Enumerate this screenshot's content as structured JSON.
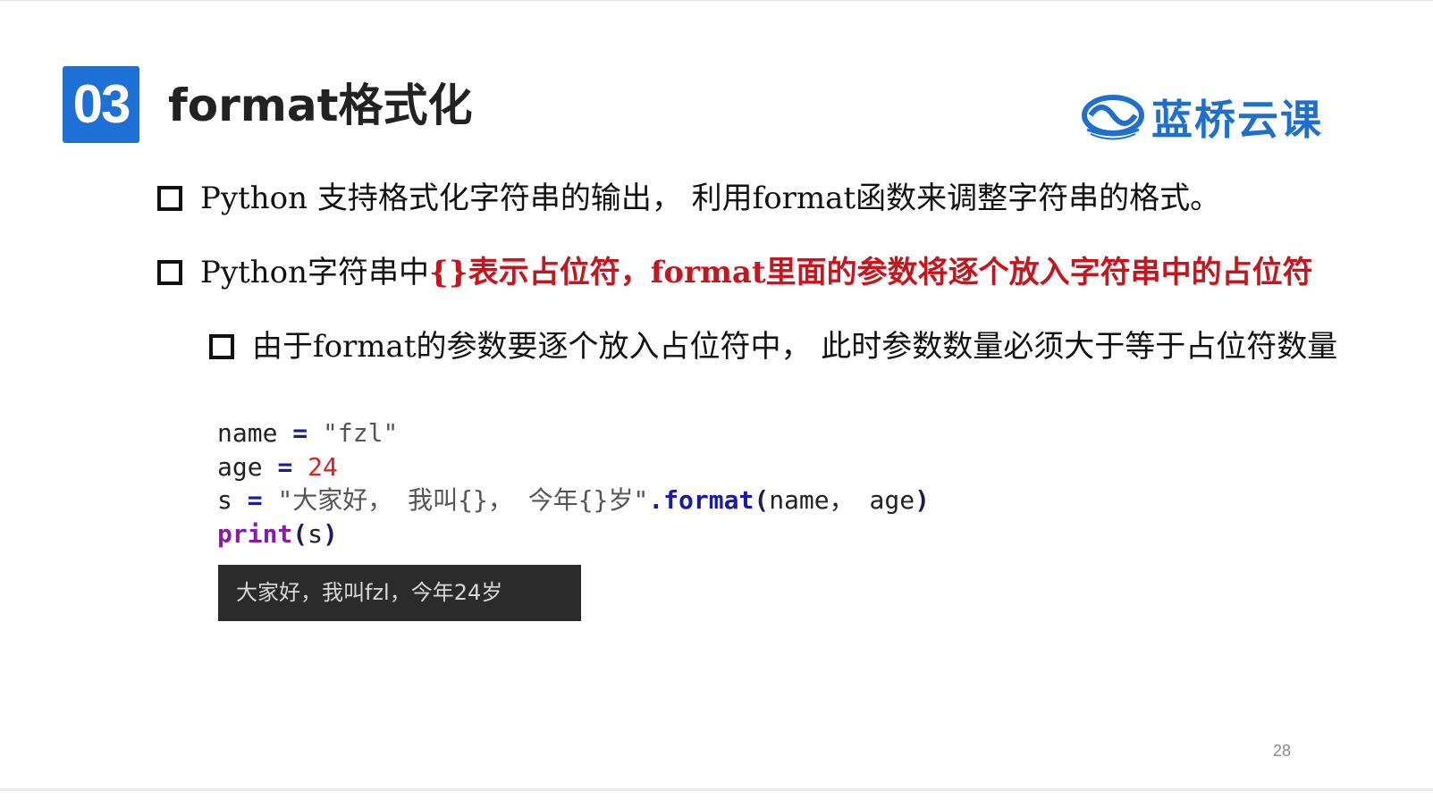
{
  "header": {
    "section_number": "03",
    "title": "format格式化",
    "logo_text": "蓝桥云课",
    "logo_color": "#1f6fd0",
    "badge_color": "#1e6fd6"
  },
  "bullets": [
    {
      "level": 1,
      "text": "Python 支持格式化字符串的输出， 利用format函数来调整字符串的格式。"
    },
    {
      "level": 1,
      "text_prefix": "Python字符串中",
      "text_highlight": "{}表示占位符，format里面的参数将逐个放入字符串中的占位符",
      "highlight_color": "#c8141c"
    },
    {
      "level": 2,
      "text": "由于format的参数要逐个放入占位符中， 此时参数数量必须大于等于占位符数量"
    }
  ],
  "code": {
    "line1": {
      "var": "name",
      "op": "=",
      "value": "\"fzl\""
    },
    "line2": {
      "var": "age",
      "op": "=",
      "value": "24"
    },
    "line3": {
      "var": "s",
      "op": "=",
      "string": "\"大家好， 我叫{}， 今年{}岁\"",
      "method": ".format",
      "open": "(",
      "args": "name， age",
      "close": ")"
    },
    "line4": {
      "func": "print",
      "open": "(",
      "arg": "s",
      "close": ")"
    }
  },
  "console": {
    "output": "大家好，我叫fzl，今年24岁"
  },
  "footer": {
    "page_number": "28"
  }
}
